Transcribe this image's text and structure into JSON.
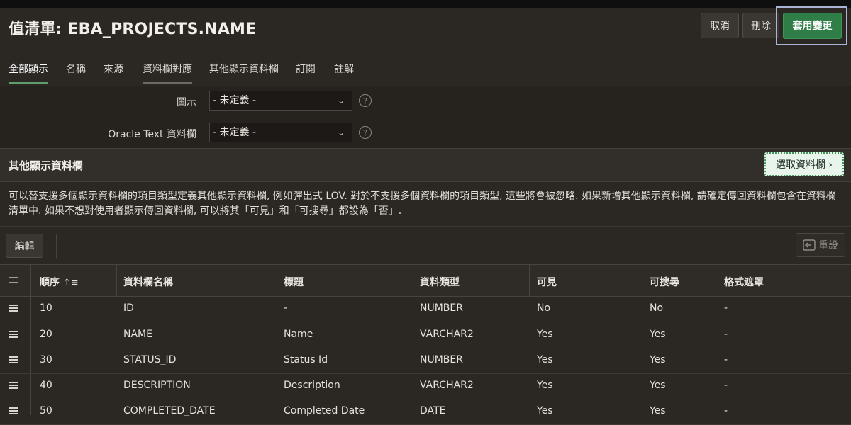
{
  "header": {
    "title": "值清單: EBA_PROJECTS.NAME",
    "cancel_label": "取消",
    "delete_label": "刪除",
    "apply_label": "套用變更"
  },
  "tabs": [
    {
      "label": "全部顯示",
      "active": true
    },
    {
      "label": "名稱"
    },
    {
      "label": "來源"
    },
    {
      "label": "資料欄對應"
    },
    {
      "label": "其他顯示資料欄"
    },
    {
      "label": "訂閱"
    },
    {
      "label": "註解"
    }
  ],
  "form": {
    "icon_label": "圖示",
    "icon_value": "- 未定義 -",
    "oracle_text_label": "Oracle Text 資料欄",
    "oracle_text_value": "- 未定義 -",
    "help_glyph": "?"
  },
  "region": {
    "title": "其他顯示資料欄",
    "select_columns_label": "選取資料欄 ›",
    "description": "可以替支援多個顯示資料欄的項目類型定義其他顯示資料欄, 例如彈出式 LOV. 對於不支援多個資料欄的項目類型, 這些將會被忽略. 如果新增其他顯示資料欄, 請確定傳回資料欄包含在資料欄清單中. 如果不想對使用者顯示傳回資料欄, 可以將其「可見」和「可搜尋」都設為「否」."
  },
  "toolbar": {
    "edit_label": "編輯",
    "reset_label": "重設",
    "reset_icon": "reset-icon"
  },
  "grid": {
    "columns": [
      "順序",
      "資料欄名稱",
      "標題",
      "資料類型",
      "可見",
      "可搜尋",
      "格式遮罩"
    ],
    "sort_indicator": "↑≡",
    "rows": [
      {
        "seq": "10",
        "name": "ID",
        "heading": "-",
        "type": "NUMBER",
        "visible": "No",
        "searchable": "No",
        "mask": "-"
      },
      {
        "seq": "20",
        "name": "NAME",
        "heading": "Name",
        "type": "VARCHAR2",
        "visible": "Yes",
        "searchable": "Yes",
        "mask": "-"
      },
      {
        "seq": "30",
        "name": "STATUS_ID",
        "heading": "Status Id",
        "type": "NUMBER",
        "visible": "Yes",
        "searchable": "Yes",
        "mask": "-"
      },
      {
        "seq": "40",
        "name": "DESCRIPTION",
        "heading": "Description",
        "type": "VARCHAR2",
        "visible": "Yes",
        "searchable": "Yes",
        "mask": "-"
      },
      {
        "seq": "50",
        "name": "COMPLETED_DATE",
        "heading": "Completed Date",
        "type": "DATE",
        "visible": "Yes",
        "searchable": "Yes",
        "mask": "-"
      }
    ]
  },
  "colors": {
    "background": "#2b2723",
    "apply_green": "#2f7d47",
    "focus_outline": "#aab4d6"
  }
}
